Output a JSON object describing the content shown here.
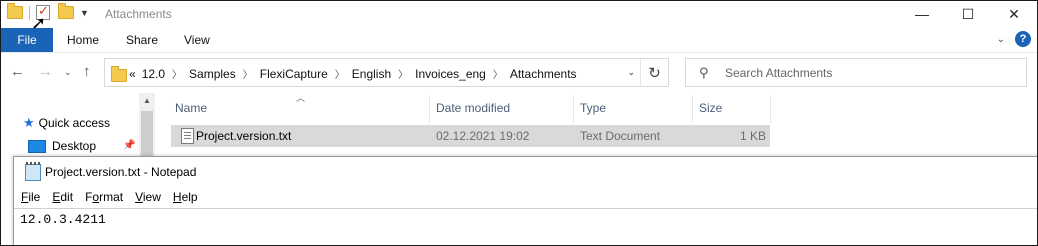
{
  "explorer": {
    "window_title": "Attachments",
    "window_controls": [
      "minimize-icon",
      "maximize-icon",
      "close-icon"
    ],
    "ribbon": {
      "file_tab": "File",
      "tabs": [
        "Home",
        "Share",
        "View"
      ]
    },
    "address": {
      "overflow": "«",
      "crumbs": [
        "12.0",
        "Samples",
        "FlexiCapture",
        "English",
        "Invoices_eng",
        "Attachments"
      ]
    },
    "search": {
      "placeholder": "Search Attachments"
    },
    "nav_pane": {
      "quick_access": "Quick access",
      "desktop": "Desktop"
    },
    "columns": {
      "name": "Name",
      "date": "Date modified",
      "type": "Type",
      "size": "Size"
    },
    "files": [
      {
        "name": "Project.version.txt",
        "date": "02.12.2021 19:02",
        "type": "Text Document",
        "size": "1 KB"
      }
    ]
  },
  "notepad": {
    "title": "Project.version.txt - Notepad",
    "menu": [
      {
        "accel": "F",
        "rest": "ile"
      },
      {
        "accel": "E",
        "rest": "dit"
      },
      {
        "accel": "",
        "rest": "F",
        "accel2": "o",
        "rest2": "rmat"
      },
      {
        "accel": "V",
        "rest": "iew"
      },
      {
        "accel": "H",
        "rest": "elp"
      }
    ],
    "content": "12.0.3.4211"
  }
}
